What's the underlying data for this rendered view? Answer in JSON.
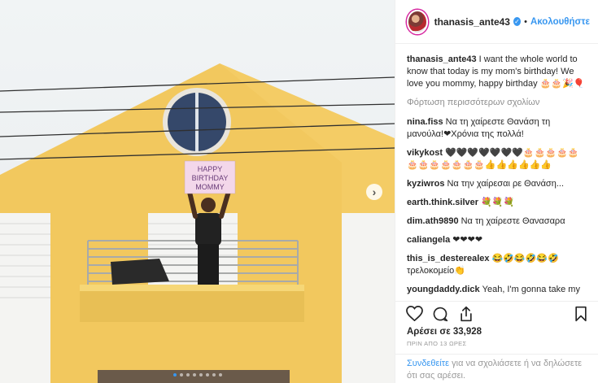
{
  "post": {
    "username": "thanasis_ante43",
    "separator": "•",
    "follow_label": "Ακολουθήστε",
    "verified_glyph": "✓",
    "photo_sign_lines": [
      "HAPPY",
      "BIRTHDAY",
      "MOMMY"
    ],
    "carousel": {
      "count": 8,
      "active": 0
    }
  },
  "comments": [
    {
      "user": "thanasis_ante43",
      "text": "I want the whole world to know that today is my mom's birthday! We love you mommy, happy birthday 🎂🎂🎉🎈"
    },
    {
      "user": "nina.fiss",
      "text": "Να τη χαίρεστε Θανάση τη μανούλα!❤Χρόνια της πολλά!"
    },
    {
      "user": "vikykost",
      "text": "🖤🖤🖤🖤🖤🖤🖤🎂🎂🎂🎂🎂🎂🎂🎂🎂🎂🎂🎂👍👍👍👍👍👍"
    },
    {
      "user": "kyziwros",
      "text": "Να την χαίρεσαι ρε Θανάση..."
    },
    {
      "user": "earth.think.silver",
      "text": "💐💐💐"
    },
    {
      "user": "dim.ath9890",
      "text": "Να τη χαίρεστε Θανασαρα"
    },
    {
      "user": "caliangela",
      "text": "❤❤❤❤"
    },
    {
      "user": "this_is_desterealex",
      "text": "😂🤣😂🤣😂🤣 τρελοκομείο👏"
    },
    {
      "user": "youngdaddy.dick",
      "text": "Yeah, I'm gonna take my horse to the old town road😎 I'm gonna ride 'til I can't no more🤷"
    }
  ],
  "load_more": "Φόρτωση περισσότερων σχολίων",
  "likes_text": "Αρέσει σε 33,928",
  "timestamp": "ΠΡΙΝ ΑΠΟ 13 ΩΡΕΣ",
  "login_prompt": {
    "link": "Συνδεθείτε",
    "rest": " για να σχολιάσετε ή να δηλώσετε ότι σας αρέσει."
  },
  "icons": {
    "like": "heart-icon",
    "comment": "comment-icon",
    "share": "share-icon",
    "save": "bookmark-icon",
    "next": "chevron-right-icon"
  },
  "colors": {
    "accent": "#3897f0",
    "muted": "#8e8e8e",
    "wall": "#f2c85e"
  }
}
